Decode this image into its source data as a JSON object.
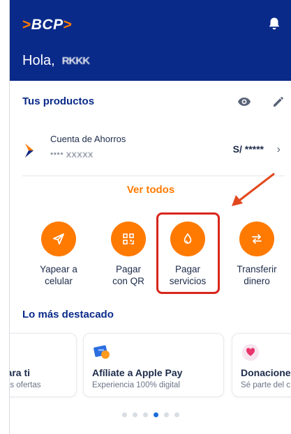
{
  "header": {
    "logo": "BCP",
    "greeting": "Hola,",
    "user_name": "RKKK"
  },
  "products": {
    "title": "Tus productos",
    "account": {
      "name": "Cuenta de Ahorros",
      "number_prefix": "****",
      "number_masked": "XXXXX",
      "balance": "S/ *****"
    },
    "view_all": "Ver todos"
  },
  "actions": [
    {
      "icon": "send-icon",
      "label_1": "Yapear a",
      "label_2": "celular"
    },
    {
      "icon": "qr-code-icon",
      "label_1": "Pagar",
      "label_2": "con QR"
    },
    {
      "icon": "drop-icon",
      "label_1": "Pagar",
      "label_2": "servicios"
    },
    {
      "icon": "transfer-icon",
      "label_1": "Transferir",
      "label_2": "dinero"
    }
  ],
  "highlights": {
    "title": "Lo más destacado",
    "cards": [
      {
        "title": "para ti",
        "subtitle": "tras ofertas"
      },
      {
        "title": "Afíliate a Apple Pay",
        "subtitle": "Experiencia 100% digital"
      },
      {
        "title": "Donaciones",
        "subtitle": "Sé parte del c"
      }
    ]
  },
  "carousel": {
    "active_index": 3,
    "count": 6
  },
  "colors": {
    "brand_blue": "#0a2a8a",
    "accent_orange": "#ff7a00",
    "highlight_red": "#d8261c"
  }
}
